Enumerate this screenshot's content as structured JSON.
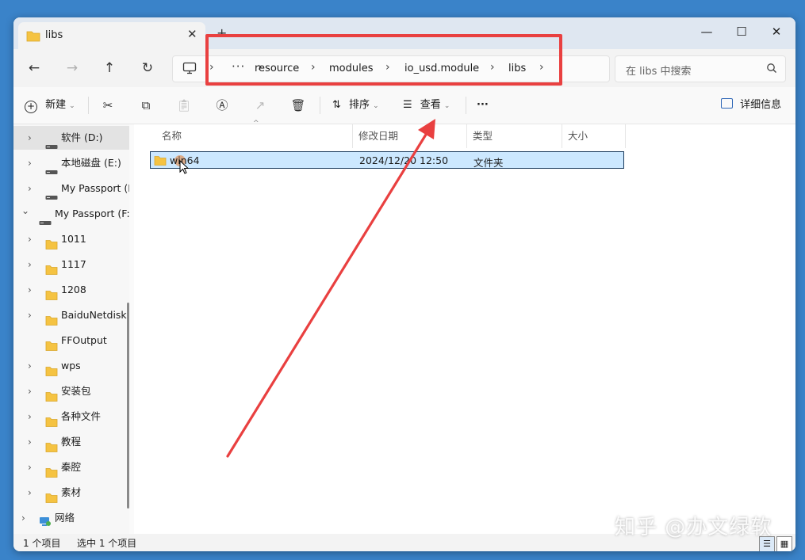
{
  "window": {
    "tab_title": "libs",
    "tab_close": "✕",
    "new_tab": "+",
    "minimize": "—",
    "maximize": "☐",
    "close": "✕"
  },
  "nav": {
    "back": "←",
    "forward": "→",
    "up": "↑",
    "refresh": "↻",
    "breadcrumb_overflow": "···",
    "separator": "›",
    "breadcrumbs": [
      "resource",
      "modules",
      "io_usd.module",
      "libs"
    ],
    "search_placeholder": "在 libs 中搜索"
  },
  "toolbar": {
    "new_label": "新建",
    "sort_label": "排序",
    "view_label": "查看",
    "more_label": "···",
    "details_label": "详细信息"
  },
  "sidebar": {
    "items": [
      {
        "label": "软件 (D:)",
        "icon": "drive-icon",
        "selected": true
      },
      {
        "label": "本地磁盘 (E:)",
        "icon": "drive-icon"
      },
      {
        "label": "My Passport (F:)",
        "icon": "drive-icon"
      },
      {
        "label": "My Passport (F:)",
        "icon": "drive-icon",
        "expanded": true
      },
      {
        "label": "1011",
        "icon": "folder-icon"
      },
      {
        "label": "1117",
        "icon": "folder-icon"
      },
      {
        "label": "1208",
        "icon": "folder-icon"
      },
      {
        "label": "BaiduNetdiskDownload",
        "icon": "folder-icon"
      },
      {
        "label": "FFOutput",
        "icon": "folder-icon"
      },
      {
        "label": "wps",
        "icon": "folder-icon"
      },
      {
        "label": "安装包",
        "icon": "folder-icon"
      },
      {
        "label": "各种文件",
        "icon": "folder-icon"
      },
      {
        "label": "教程",
        "icon": "folder-icon"
      },
      {
        "label": "秦腔",
        "icon": "folder-icon"
      },
      {
        "label": "素材",
        "icon": "folder-icon"
      },
      {
        "label": "网络",
        "icon": "network-icon"
      }
    ]
  },
  "columns": {
    "name": "名称",
    "modified": "修改日期",
    "type": "类型",
    "size": "大小"
  },
  "files": [
    {
      "name": "win64",
      "modified": "2024/12/20 12:50",
      "type": "文件夹",
      "size": ""
    }
  ],
  "status": {
    "count": "1 个项目",
    "selected": "选中 1 个项目"
  },
  "watermark": "知乎 @办文绿软",
  "colors": {
    "highlight_box": "#e94040",
    "selection": "#cce8ff",
    "folder": "#f5c342",
    "desktop": "#3a83c9"
  }
}
